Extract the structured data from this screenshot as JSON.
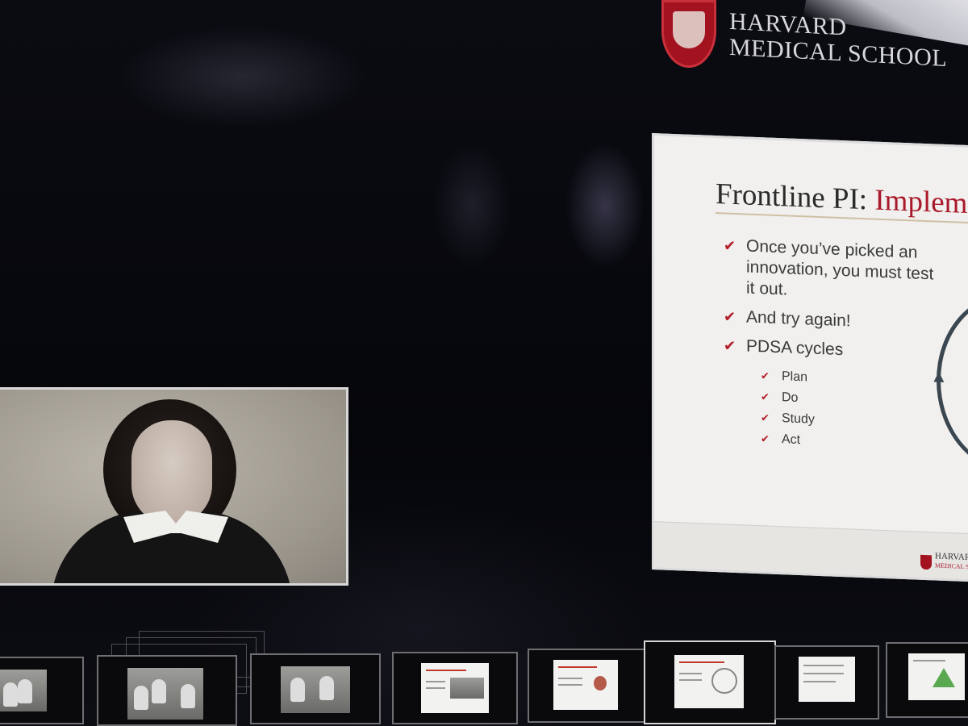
{
  "header": {
    "institution_line1": "HARVARD",
    "institution_line2": "MEDICAL SCHOOL",
    "logo": "harvard-shield-icon"
  },
  "speaker": {
    "label": "speaker-video"
  },
  "slide": {
    "title_part1": "Frontline PI: ",
    "title_part2": "Impleme",
    "bullets": [
      "Once you’ve picked an innovation, you must test it out.",
      "And try again!",
      "PDSA cycles"
    ],
    "sub_bullets": [
      "Plan",
      "Do",
      "Study",
      "Act"
    ],
    "footer_line1": "HARVARD",
    "footer_line2": "MEDICAL SCHOOL",
    "accent_color": "#a9192b",
    "check_icon": "check-mark-icon"
  },
  "filmstrip": {
    "selected_index": 5,
    "thumbnails": [
      {
        "kind": "video"
      },
      {
        "kind": "video"
      },
      {
        "kind": "video"
      },
      {
        "kind": "slide"
      },
      {
        "kind": "slide"
      },
      {
        "kind": "slide"
      },
      {
        "kind": "slide"
      },
      {
        "kind": "slide"
      }
    ]
  }
}
